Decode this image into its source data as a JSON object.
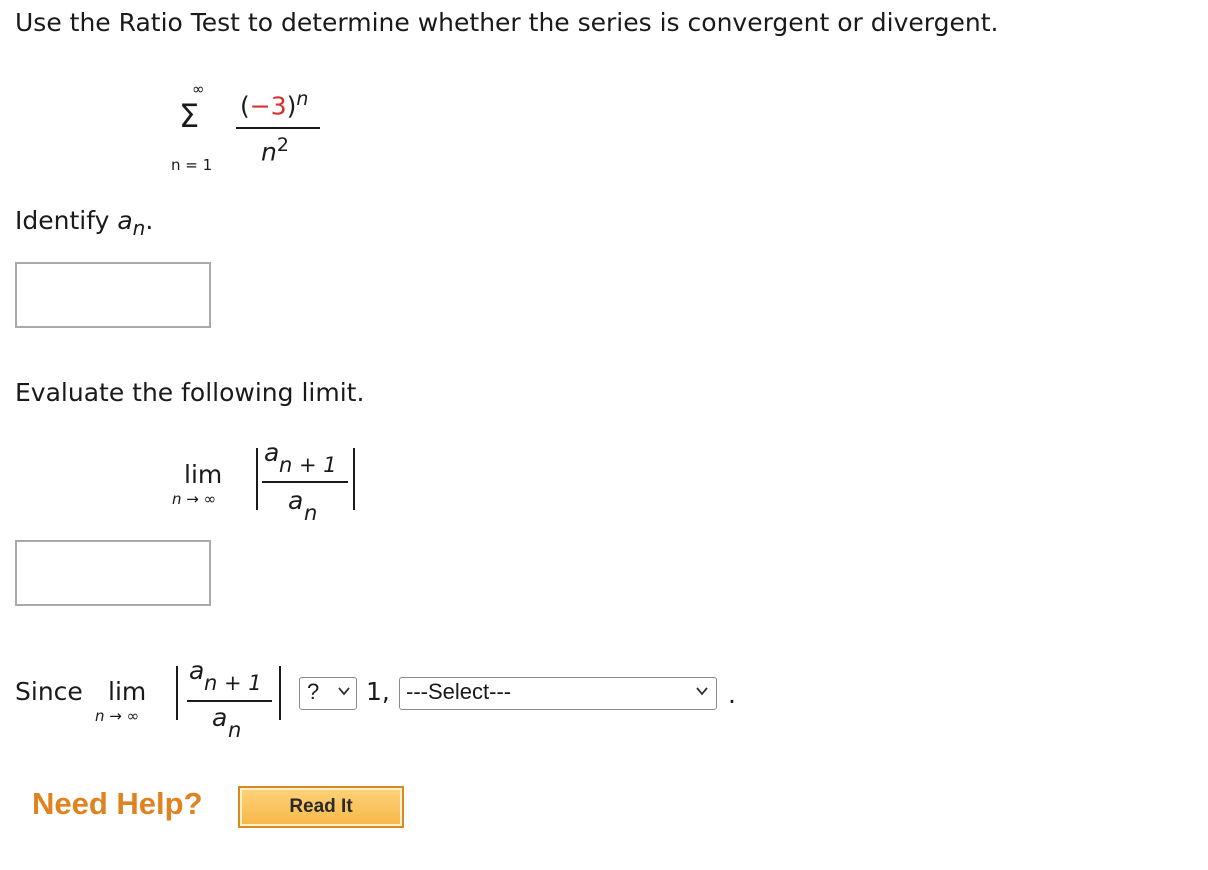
{
  "question": {
    "instruction": "Use the Ratio Test to determine whether the series is convergent or divergent."
  },
  "series": {
    "sigma": "Σ",
    "upper_limit": "∞",
    "lower_limit": "n = 1",
    "numerator_open": "(",
    "numerator_minus": "−3",
    "numerator_close": ")",
    "numerator_exponent": "n",
    "denominator_base": "n",
    "denominator_exponent": "2",
    "minus_color": "#d32f2f"
  },
  "part1": {
    "prompt": "Identify",
    "symbol": "a",
    "subscript": "n",
    "period": ".",
    "answer_value": ""
  },
  "part2": {
    "prompt": "Evaluate the following limit.",
    "lim": "lim",
    "lim_sub": "n → ∞",
    "num_a": "a",
    "num_sub": "n + 1",
    "den_a": "a",
    "den_sub": "n",
    "answer_value": ""
  },
  "part3": {
    "since": "Since",
    "lim": "lim",
    "lim_sub": "n → ∞",
    "num_a": "a",
    "num_sub": "n + 1",
    "den_a": "a",
    "den_sub": "n",
    "comparison_value": "?",
    "after_comparison": "1,",
    "conclusion_value": "---Select---",
    "end_period": "."
  },
  "help": {
    "label": "Need Help?",
    "read_button": "Read It"
  }
}
